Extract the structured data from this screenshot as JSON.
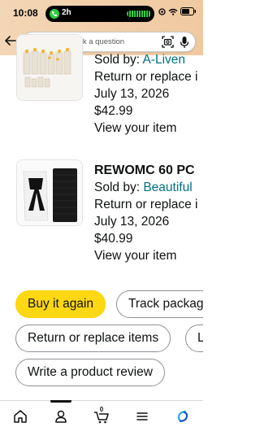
{
  "status_bar": {
    "time": "10:08",
    "call_duration": "2h"
  },
  "search": {
    "placeholder": "Search or ask a question"
  },
  "orders": [
    {
      "title": "",
      "sold_by_prefix": "Sold by: ",
      "seller": "A-Liven",
      "return_text": "Return or replace i",
      "return_date": "July 13, 2026",
      "price": "$42.99",
      "view_link": "View your item"
    },
    {
      "title": "REWOMC 60 PC",
      "sold_by_prefix": "Sold by: ",
      "seller": "Beautiful",
      "return_text": "Return or replace i",
      "return_date": "July 13, 2026",
      "price": "$40.99",
      "view_link": "View your item"
    }
  ],
  "actions": {
    "buy_again": "Buy it again",
    "track": "Track packag",
    "return_replace": "Return or replace items",
    "partial": "L",
    "review": "Write a product review"
  },
  "bottom_nav": {
    "items": [
      "home-icon",
      "account-icon",
      "cart-icon",
      "menu-icon",
      "rufus-icon"
    ],
    "cart_count": "0",
    "active": "account-icon"
  },
  "colors": {
    "header": "#f3d6b6",
    "link": "#007185",
    "buy_again": "#ffd814"
  }
}
